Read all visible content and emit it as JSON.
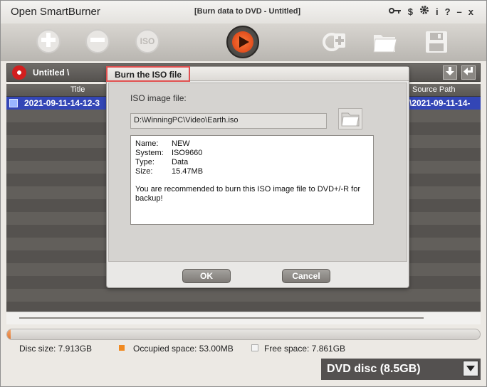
{
  "app": {
    "title": "Open SmartBurner",
    "document_title": "[Burn data to DVD - Untitled]",
    "title_icons": [
      "key-icon",
      "dollar-icon",
      "gear-icon",
      "info-icon",
      "help-icon",
      "minimize-icon",
      "close-icon"
    ],
    "title_glyphs": {
      "dollar": "$",
      "info": "i",
      "help": "?",
      "minimize": "–",
      "close": "x"
    }
  },
  "toolbar": {
    "iso_label": "ISO"
  },
  "pathbar": {
    "label": "Untitled \\"
  },
  "table": {
    "columns": {
      "title": "Title",
      "source": "Source Path"
    },
    "rows": [
      {
        "title": "2021-09-11-14-12-3",
        "source": "\\2021-09-11-14-"
      }
    ]
  },
  "status": {
    "disc_size": "Disc size: 7.913GB",
    "occupied": "Occupied space: 53.00MB",
    "free": "Free space: 7.861GB",
    "progress_fraction": 0.007
  },
  "disc_select": {
    "value": "DVD disc (8.5GB)"
  },
  "dialog": {
    "title": "Burn the ISO file",
    "iso_label": "ISO image file:",
    "iso_path": "D:\\WinningPC\\Video\\Earth.iso",
    "info": [
      {
        "key": "Name:",
        "value": "NEW"
      },
      {
        "key": "System:",
        "value": "ISO9660"
      },
      {
        "key": "Type:",
        "value": "Data"
      },
      {
        "key": "Size:",
        "value": "15.47MB"
      }
    ],
    "note": "You are recommended to burn this ISO image file to DVD+/-R for backup!",
    "ok_label": "OK",
    "cancel_label": "Cancel"
  },
  "colors": {
    "accent": "#e17a34",
    "selection": "#3346b6",
    "burn": "#d43a10"
  }
}
